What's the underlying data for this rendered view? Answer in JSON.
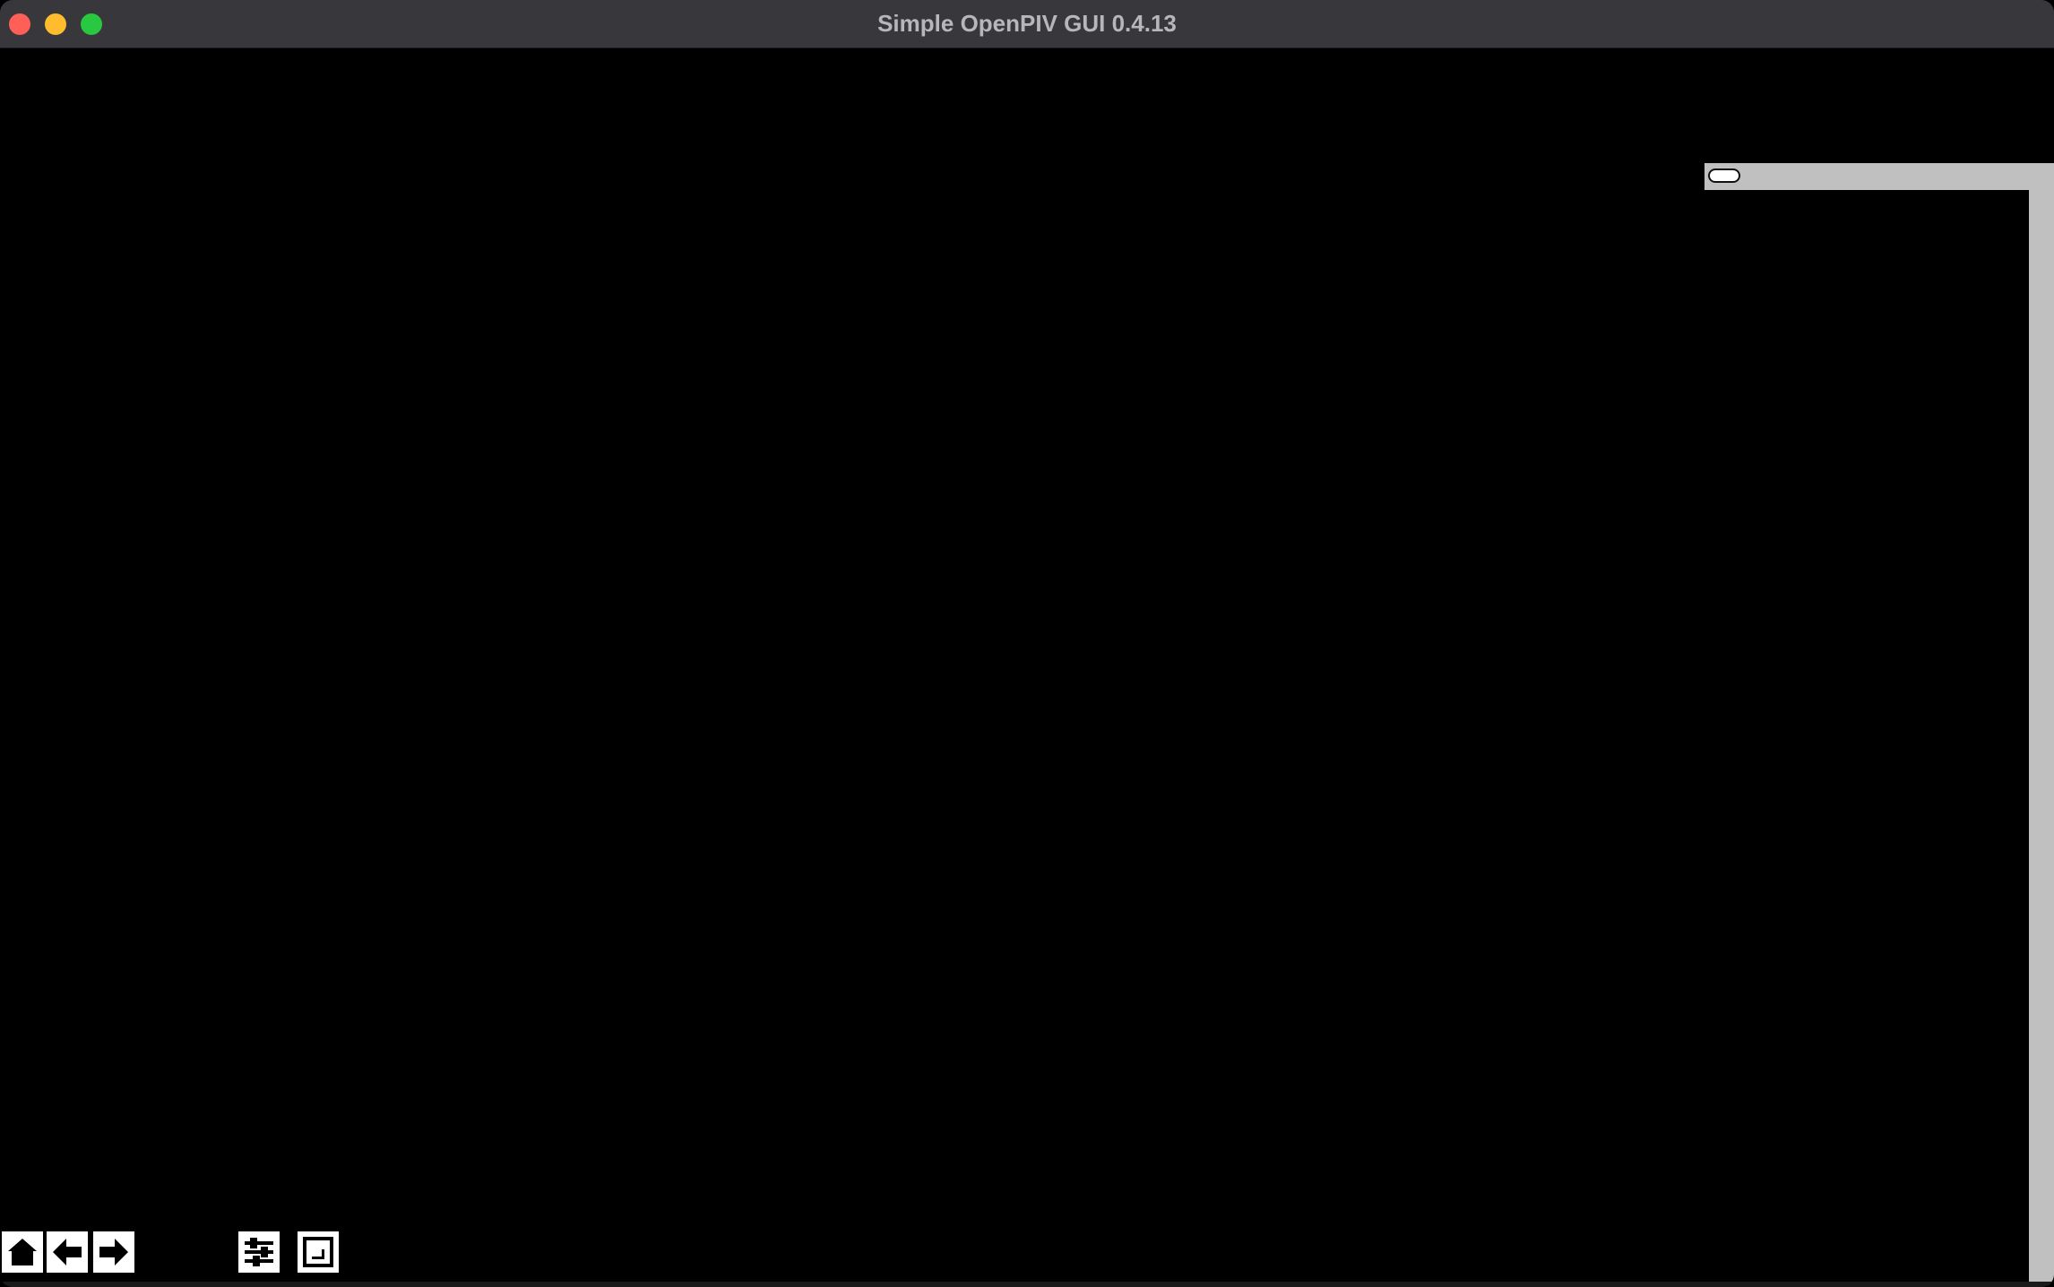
{
  "window": {
    "title": "Simple OpenPIV GUI 0.4.13",
    "controls": {
      "close_color": "#fe5f57",
      "minimize_color": "#febc2e",
      "zoom_color": "#28c840"
    }
  },
  "canvas": {
    "background": "#000000"
  },
  "toolbar": {
    "buttons": [
      {
        "name": "home",
        "icon": "home-icon"
      },
      {
        "name": "back",
        "icon": "arrow-left-icon"
      },
      {
        "name": "forward",
        "icon": "arrow-right-icon"
      },
      {
        "name": "configure-subplots",
        "icon": "sliders-icon"
      },
      {
        "name": "save",
        "icon": "save-icon"
      }
    ]
  },
  "side_panel": {
    "toggle_icon": "pill-toggle-icon",
    "background": "#c0c0c0"
  }
}
